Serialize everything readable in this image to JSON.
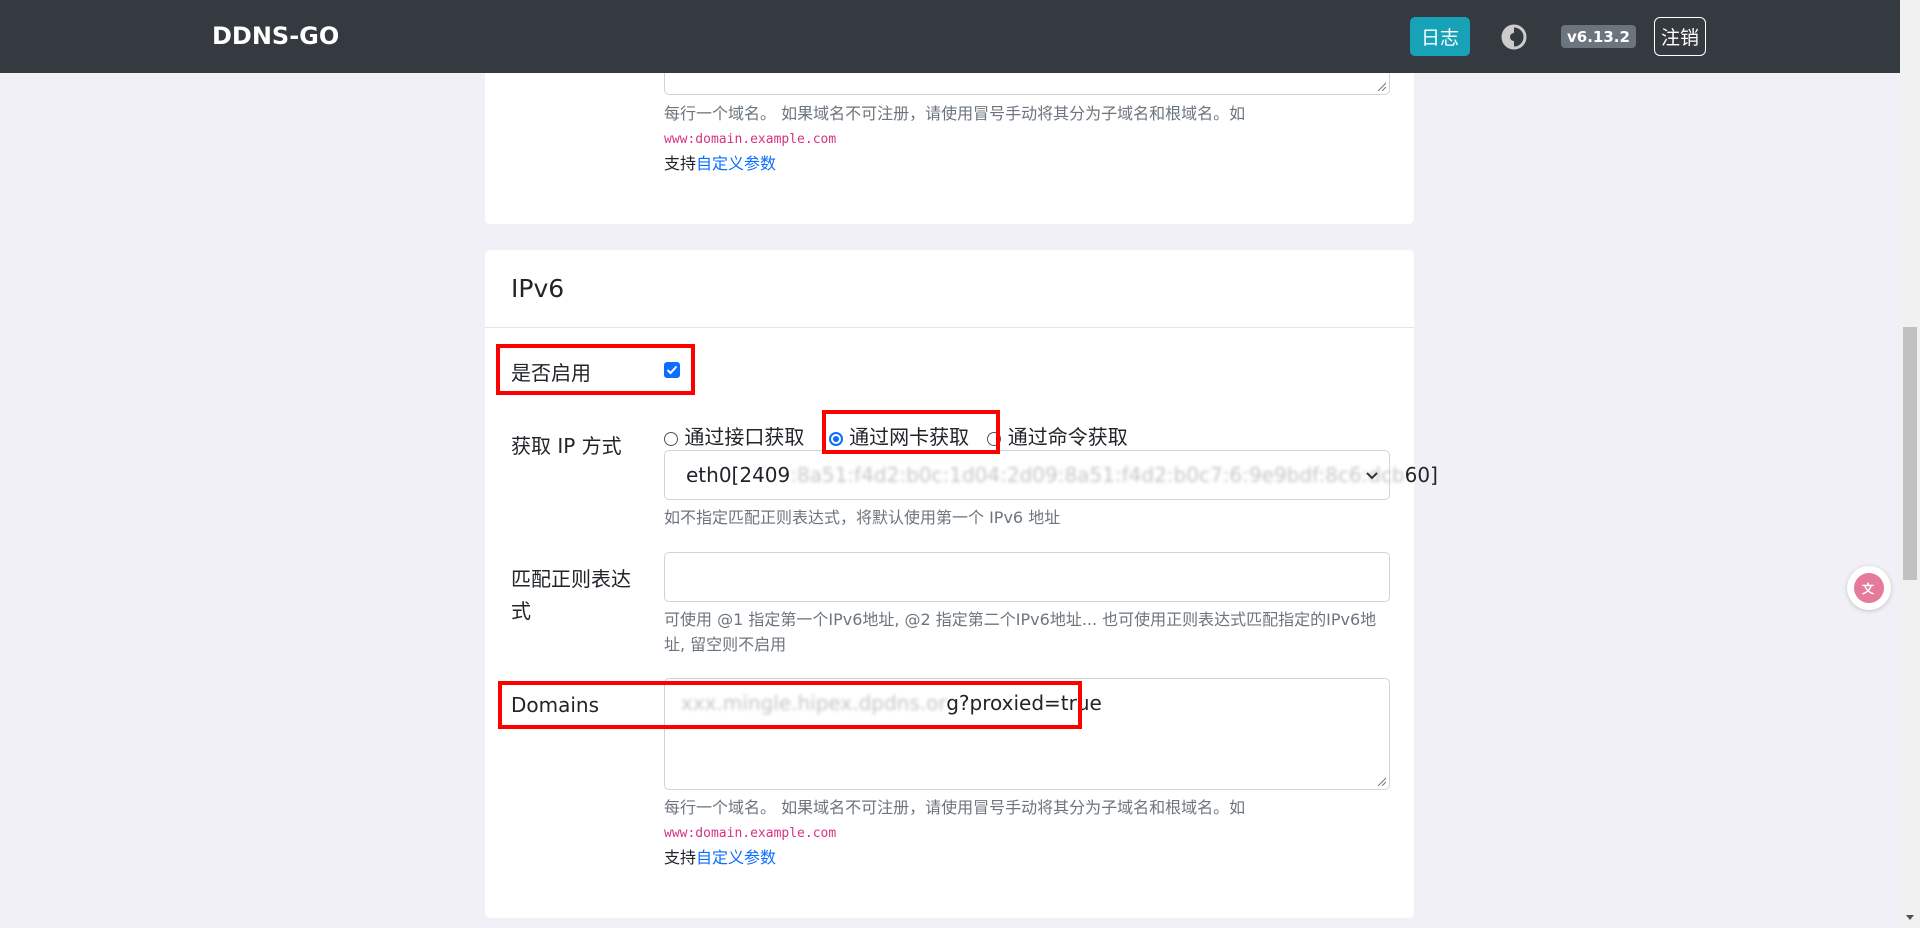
{
  "navbar": {
    "brand": "DDNS-GO",
    "log_button": "日志",
    "theme_icon": "half-moon-icon",
    "version": "v6.13.2",
    "logout_button": "注销"
  },
  "top_card": {
    "help_text": "每行一个域名。 如果域名不可注册，请使用冒号手动将其分为子域名和根域名。如",
    "help_example": "www:domain.example.com",
    "custom_params_prefix": "支持",
    "custom_params_link": "自定义参数"
  },
  "ipv6": {
    "title": "IPv6",
    "enable_label": "是否启用",
    "enabled": true,
    "ip_method_label": "获取 IP 方式",
    "methods": [
      "通过接口获取",
      "通过网卡获取",
      "通过命令获取"
    ],
    "selected_method": "通过网卡获取",
    "interface_value_prefix": "eth0[2409",
    "interface_value_blurred": ":8a51:f4d2:b0c:1d04:2d09:8a51:f4d2:b0c7:6:9e9bdf:8c6:dcb",
    "interface_value_suffix": "60]",
    "interface_help": "如不指定匹配正则表达式，将默认使用第一个 IPv6 地址",
    "regex_label": "匹配正则表达式",
    "regex_value": "",
    "regex_help": "可使用 @1 指定第一个IPv6地址, @2 指定第二个IPv6地址... 也可使用正则表达式匹配指定的IPv6地址, 留空则不启用",
    "domains_label": "Domains",
    "domains_value_blurred": "xxx.mingle.hipex.dpdns.or",
    "domains_value_suffix": "g?proxied=true",
    "domains_help": "每行一个域名。 如果域名不可注册，请使用冒号手动将其分为子域名和根域名。如",
    "domains_example": "www:domain.example.com",
    "custom_params_prefix": "支持",
    "custom_params_link": "自定义参数"
  },
  "side_widget_icon": "translate-icon"
}
